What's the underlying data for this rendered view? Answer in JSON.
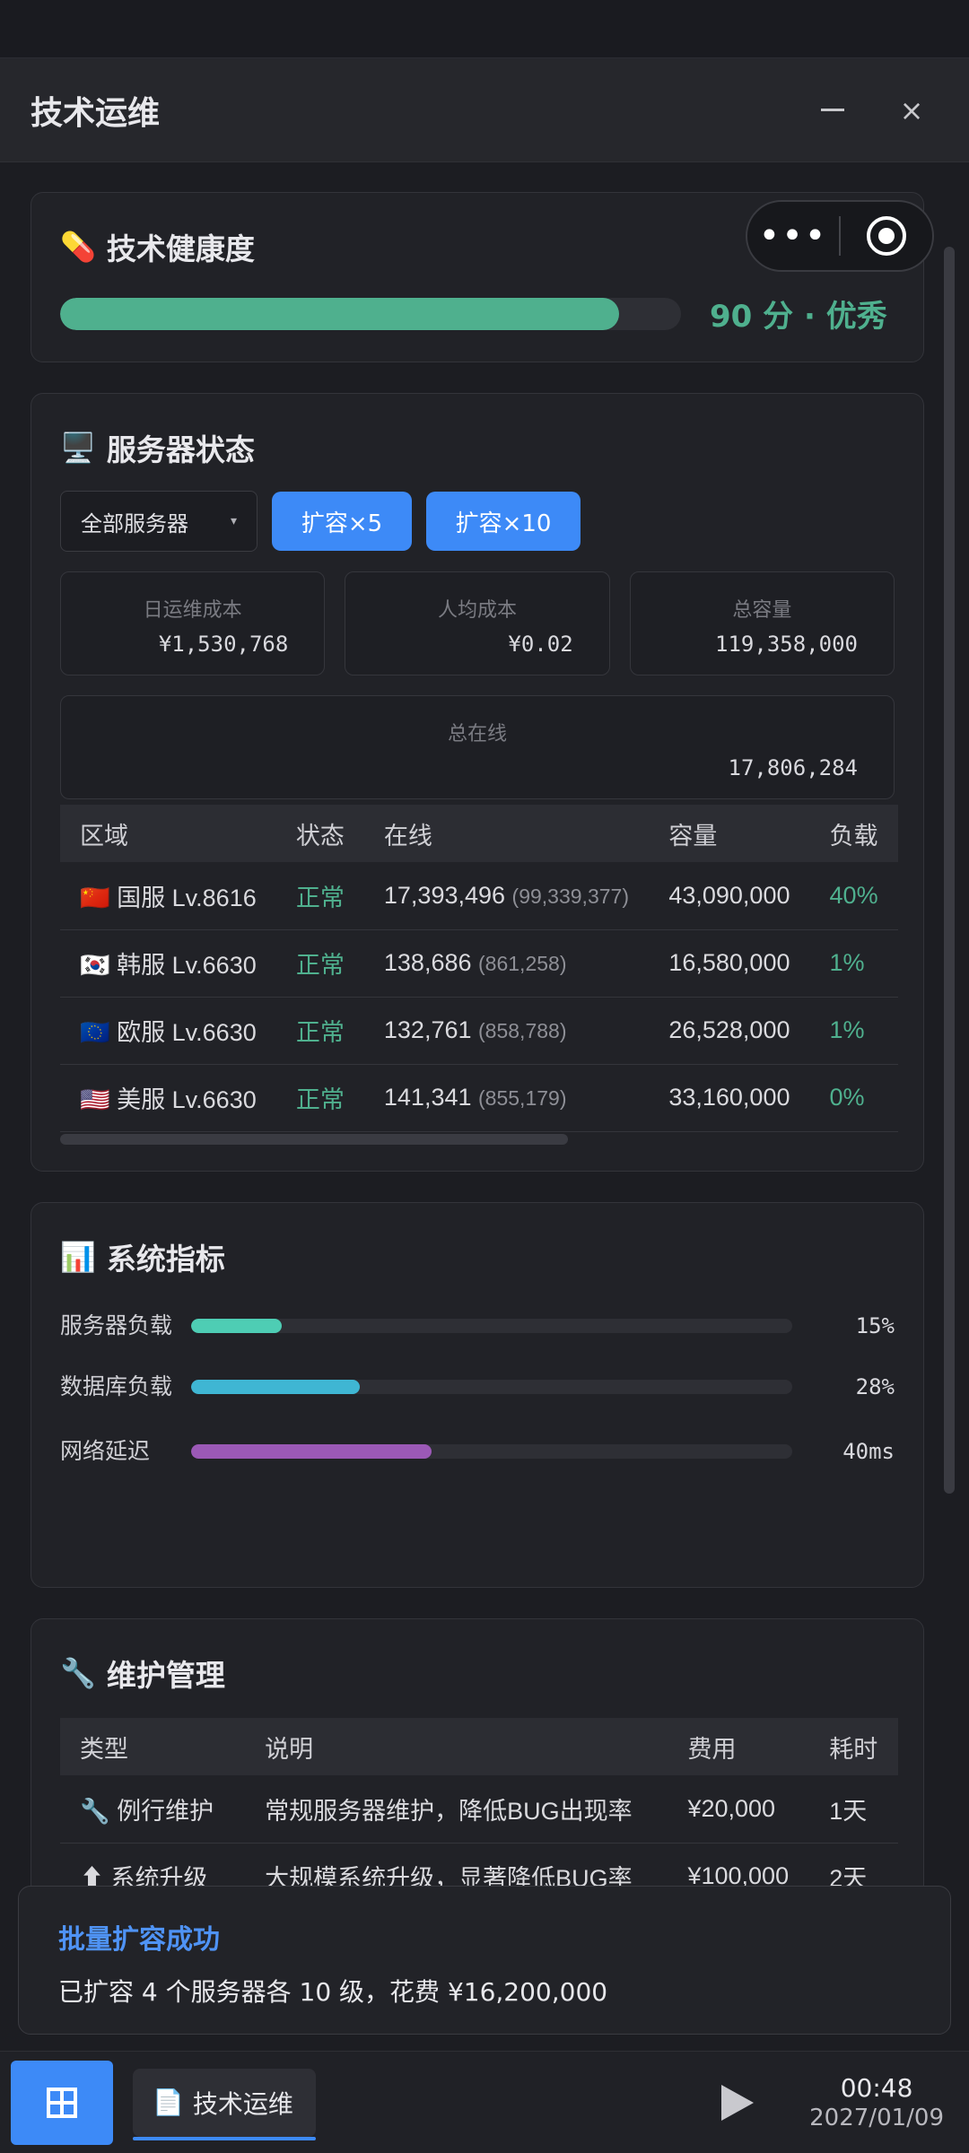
{
  "window": {
    "title": "技术运维",
    "minimize_icon": "minimize-icon",
    "close_label": "×"
  },
  "capsule": {
    "more_label": "•••"
  },
  "health": {
    "emoji": "💊",
    "title": "技术健康度",
    "progress": 0.9,
    "score_text": "90 分 · 优秀",
    "color": "#4fb08e"
  },
  "servers": {
    "emoji": "🖥️",
    "title": "服务器状态",
    "select_value": "全部服务器",
    "select_caret": "▾",
    "expand5_label": "扩容×5",
    "expand10_label": "扩容×10",
    "stats": {
      "daily_cost_label": "日运维成本",
      "daily_cost_value": "¥1,530,768",
      "per_user_label": "人均成本",
      "per_user_value": "¥0.02",
      "capacity_label": "总容量",
      "capacity_value": "119,358,000",
      "online_label": "总在线",
      "online_value": "17,806,284"
    },
    "columns": [
      "区域",
      "状态",
      "在线",
      "容量",
      "负载"
    ],
    "rows": [
      {
        "flag": "🇨🇳",
        "region": "国服 Lv.8616",
        "status": "正常",
        "online": "17,393,496",
        "online_sub": "(99,339,377)",
        "capacity": "43,090,000",
        "load": "40%"
      },
      {
        "flag": "🇰🇷",
        "region": "韩服 Lv.6630",
        "status": "正常",
        "online": "138,686",
        "online_sub": "(861,258)",
        "capacity": "16,580,000",
        "load": "1%"
      },
      {
        "flag": "🇪🇺",
        "region": "欧服 Lv.6630",
        "status": "正常",
        "online": "132,761",
        "online_sub": "(858,788)",
        "capacity": "26,528,000",
        "load": "1%"
      },
      {
        "flag": "🇺🇸",
        "region": "美服 Lv.6630",
        "status": "正常",
        "online": "141,341",
        "online_sub": "(855,179)",
        "capacity": "33,160,000",
        "load": "0%"
      }
    ]
  },
  "metrics": {
    "emoji": "📊",
    "title": "系统指标",
    "items": [
      {
        "name": "服务器负载",
        "value": 0.15,
        "text": "15%",
        "color": "#4ecdb4"
      },
      {
        "name": "数据库负载",
        "value": 0.28,
        "text": "28%",
        "color": "#3fb6d3"
      },
      {
        "name": "网络延迟",
        "value": 0.4,
        "text": "40ms",
        "color": "#9b59b6"
      }
    ]
  },
  "maintenance": {
    "emoji": "🔧",
    "title": "维护管理",
    "columns": [
      "类型",
      "说明",
      "费用",
      "耗时"
    ],
    "rows": [
      {
        "icon": "🔧",
        "type": "例行维护",
        "desc": "常规服务器维护，降低BUG出现率",
        "cost": "¥20,000",
        "time": "1天"
      },
      {
        "icon": "⬆",
        "type": "系统升级",
        "desc": "大规模系统升级，显著降低BUG率",
        "cost": "¥100,000",
        "time": "2天"
      }
    ]
  },
  "toast": {
    "title": "批量扩容成功",
    "message": "已扩容 4 个服务器各 10 级，花费 ¥16,200,000"
  },
  "taskbar": {
    "task_icon": "📄",
    "task_label": "技术运维",
    "time": "00:48",
    "date": "2027/01/09"
  }
}
